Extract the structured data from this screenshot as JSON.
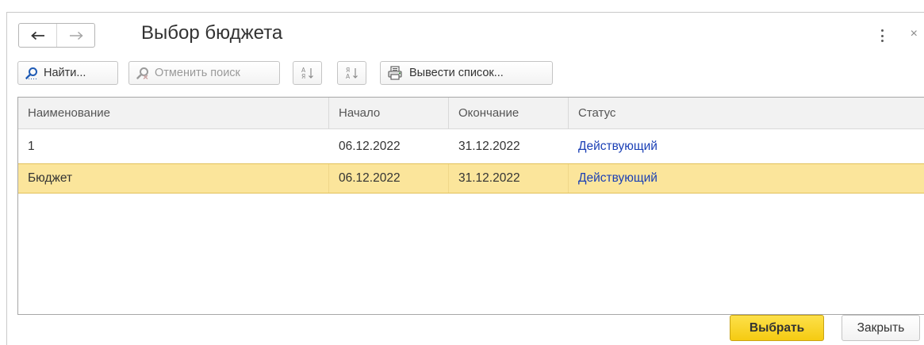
{
  "window": {
    "title": "Выбор бюджета"
  },
  "toolbar": {
    "find_label": "Найти...",
    "cancel_search_label": "Отменить поиск",
    "print_list_label": "Вывести список..."
  },
  "table": {
    "columns": [
      "Наименование",
      "Начало",
      "Окончание",
      "Статус"
    ],
    "rows": [
      {
        "name": "1",
        "start": "06.12.2022",
        "end": "31.12.2022",
        "status": "Действующий"
      },
      {
        "name": "Бюджет",
        "start": "06.12.2022",
        "end": "31.12.2022",
        "status": "Действующий"
      }
    ],
    "selected_row": 1
  },
  "footer": {
    "select_label": "Выбрать",
    "close_label": "Закрыть"
  },
  "icons": {
    "back": "arrow-left-icon",
    "forward": "arrow-right-icon",
    "more": "more-vertical-icon",
    "close": "close-icon",
    "find": "search-icon",
    "cancel_search": "search-cancel-icon",
    "sort_asc": "sort-ascending-icon",
    "sort_desc": "sort-descending-icon",
    "print_list": "print-list-icon"
  },
  "colors": {
    "selected_row": "#fbe59b",
    "primary_button": "#f5cb12",
    "status_text": "#1a3fb5",
    "find_icon": "#1f5bb5"
  }
}
